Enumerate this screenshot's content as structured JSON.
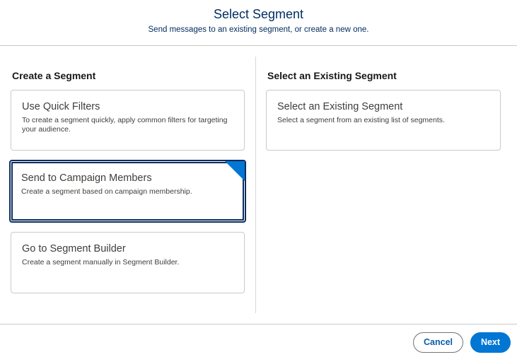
{
  "header": {
    "title": "Select Segment",
    "subtitle": "Send messages to an existing segment, or create a new one."
  },
  "create_section": {
    "title": "Create a Segment",
    "tiles": [
      {
        "title": "Use Quick Filters",
        "description": "To create a segment quickly, apply common filters for targeting your audience.",
        "selected": false
      },
      {
        "title": "Send to Campaign Members",
        "description": "Create a segment based on campaign membership.",
        "selected": true
      },
      {
        "title": "Go to Segment Builder",
        "description": "Create a segment manually in Segment Builder.",
        "selected": false
      }
    ]
  },
  "existing_section": {
    "title": "Select an Existing Segment",
    "tiles": [
      {
        "title": "Select an Existing Segment",
        "description": "Select a segment from an existing list of segments.",
        "selected": false
      }
    ]
  },
  "footer": {
    "cancel_label": "Cancel",
    "next_label": "Next"
  },
  "colors": {
    "brand": "#0176d3",
    "header_text": "#032d60",
    "selected_border": "#0b2c5e"
  }
}
